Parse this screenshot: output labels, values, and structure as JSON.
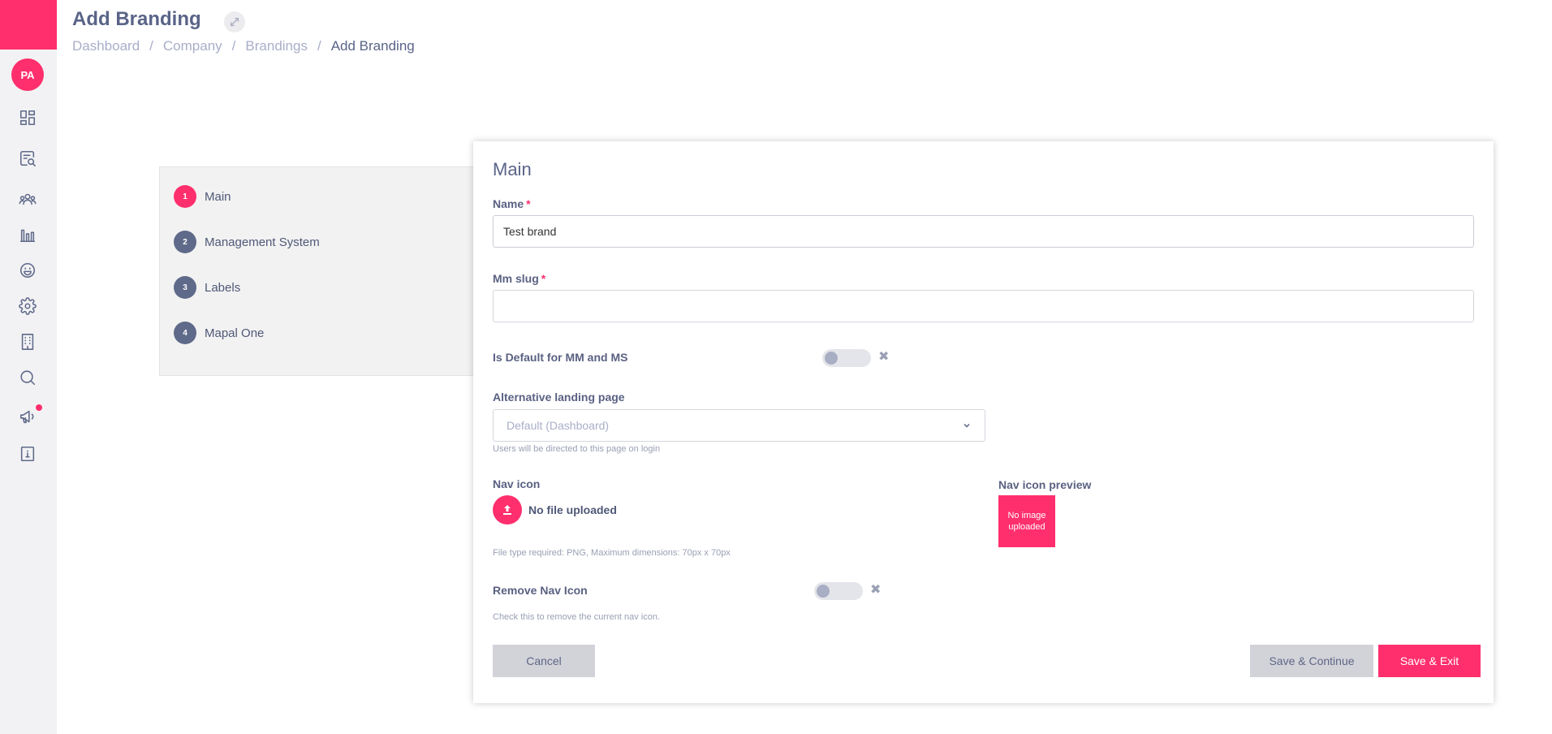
{
  "header": {
    "title": "Add Branding",
    "breadcrumb": [
      "Dashboard",
      "Company",
      "Brandings",
      "Add Branding"
    ],
    "separator": "/"
  },
  "sidebar": {
    "avatar_initials": "PA",
    "icons": [
      "dashboard-icon",
      "search-document-icon",
      "users-icon",
      "bar-chart-icon",
      "smiley-icon",
      "gear-icon",
      "building-icon",
      "search-icon",
      "megaphone-icon",
      "info-book-icon"
    ],
    "accent_color": "#ff2f6d"
  },
  "steps": [
    {
      "number": "1",
      "label": "Main",
      "active": true
    },
    {
      "number": "2",
      "label": "Management System",
      "active": false
    },
    {
      "number": "3",
      "label": "Labels",
      "active": false
    },
    {
      "number": "4",
      "label": "Mapal One",
      "active": false
    }
  ],
  "form": {
    "title": "Main",
    "name": {
      "label": "Name",
      "required_mark": "*",
      "value": "Test brand"
    },
    "mm_slug": {
      "label": "Mm slug",
      "required_mark": "*",
      "value": ""
    },
    "is_default": {
      "label": "Is Default for MM and MS",
      "checked": false
    },
    "landing_page": {
      "label": "Alternative landing page",
      "selected": "Default (Dashboard)",
      "help": "Users will be directed to this page on login"
    },
    "nav_icon": {
      "label": "Nav icon",
      "status": "No file uploaded",
      "help": "File type required: PNG, Maximum dimensions: 70px x 70px"
    },
    "nav_icon_preview": {
      "label": "Nav icon preview",
      "placeholder": "No image uploaded"
    },
    "remove_nav_icon": {
      "label": "Remove Nav Icon",
      "checked": false,
      "help": "Check this to remove the current nav icon."
    },
    "buttons": {
      "cancel": "Cancel",
      "save_continue": "Save & Continue",
      "save_exit": "Save & Exit"
    }
  }
}
